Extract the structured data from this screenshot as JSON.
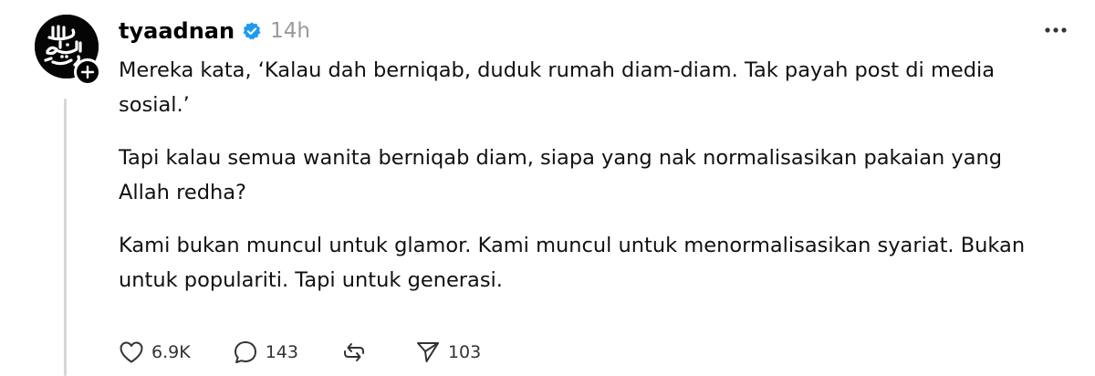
{
  "post": {
    "author": {
      "username": "tyaadnan",
      "verified": true,
      "avatar_icon": "arabic-calligraphy-avatar",
      "follow_icon": "plus-icon"
    },
    "timestamp": "14h",
    "paragraphs": [
      "Mereka kata, ‘Kalau dah berniqab, duduk rumah diam-diam. Tak payah post di media sosial.’",
      "Tapi kalau semua wanita berniqab diam, siapa yang nak normalisasikan pakaian yang Allah redha?",
      "Kami bukan muncul untuk glamor. Kami muncul untuk menormalisasikan syariat. Bukan untuk populariti. Tapi untuk generasi."
    ],
    "actions": {
      "like": {
        "icon": "heart-icon",
        "count": "6.9K"
      },
      "reply": {
        "icon": "comment-icon",
        "count": "143"
      },
      "repost": {
        "icon": "repost-icon"
      },
      "share": {
        "icon": "send-icon",
        "count": "103"
      }
    },
    "more_icon": "more-dots-icon"
  },
  "colors": {
    "verified_badge": "#1d9bf0",
    "timestamp": "#9a9a9a",
    "thread_line": "#d6d6d6",
    "text": "#111111"
  }
}
